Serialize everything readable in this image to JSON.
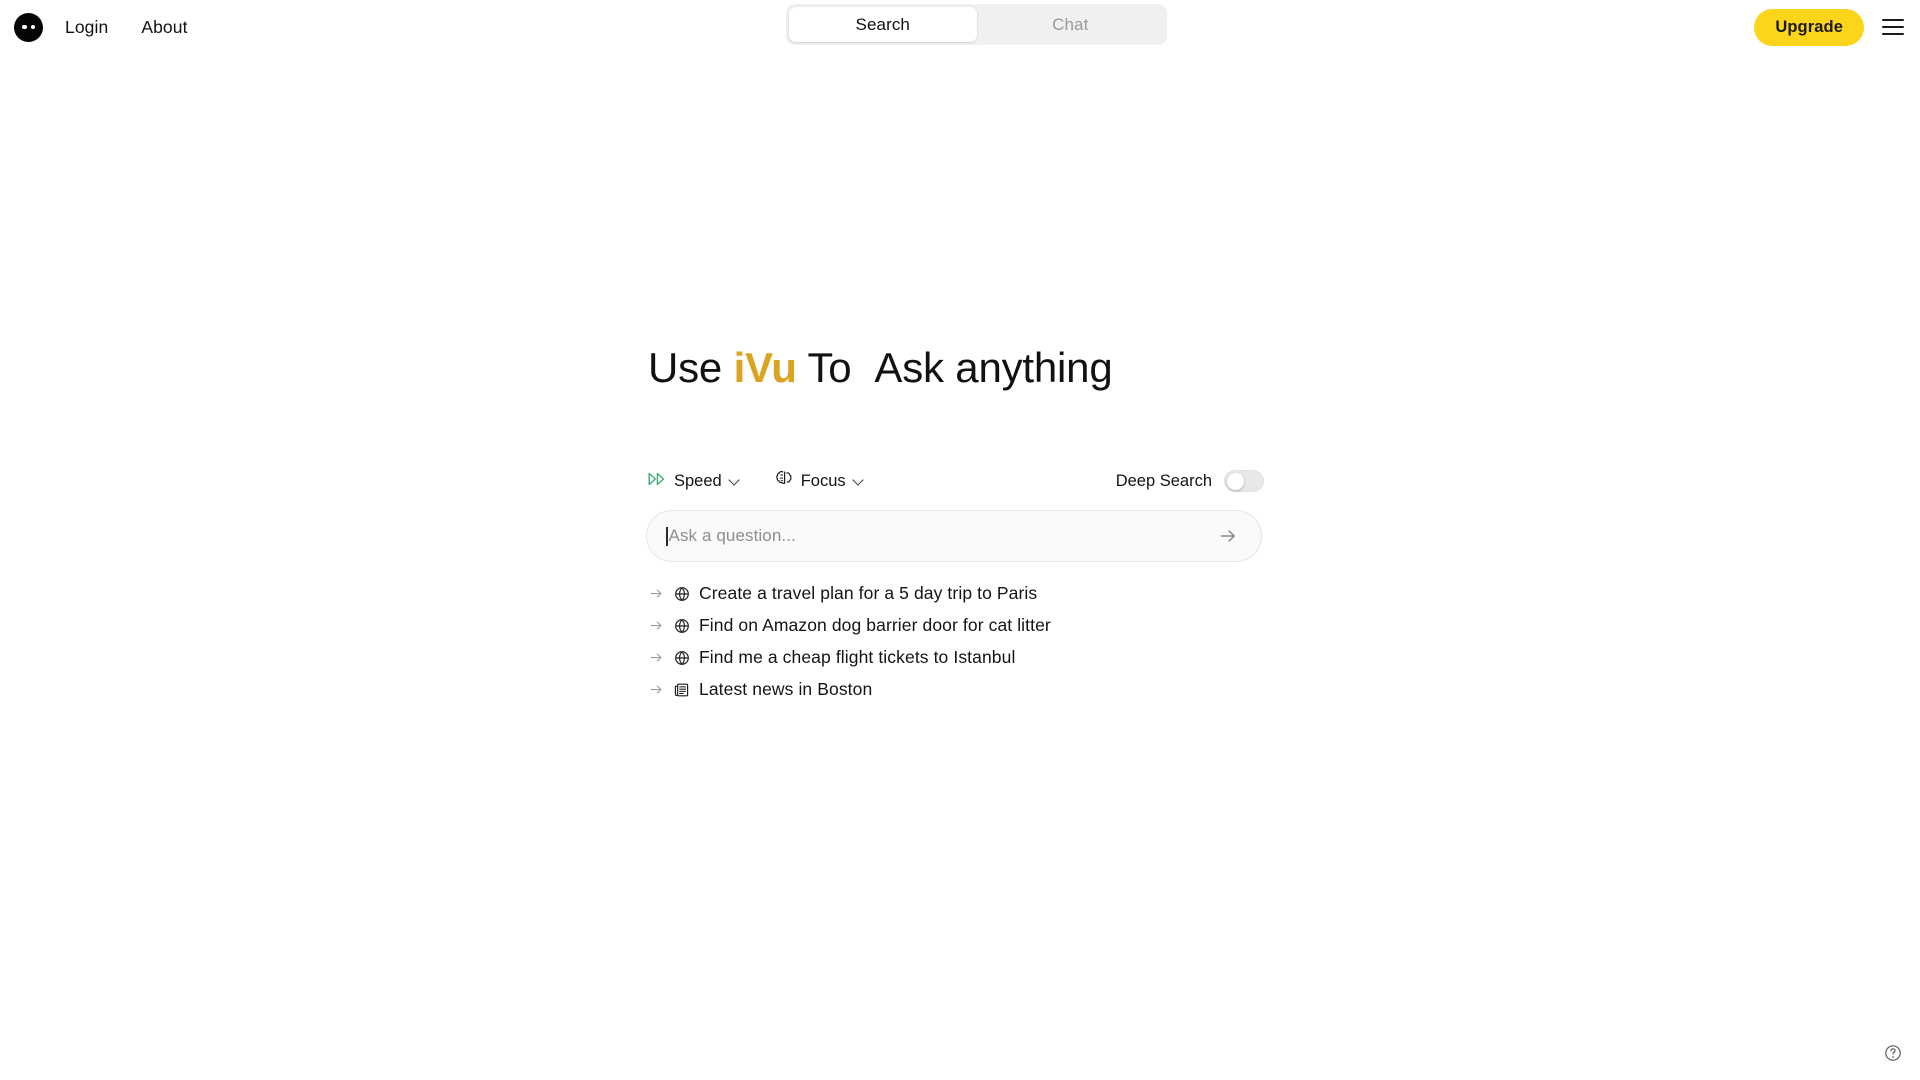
{
  "topbar": {
    "logo": {
      "icon": "app-logo-dots-icon"
    },
    "nav": [
      {
        "label": "Login",
        "name": "nav-link-login"
      },
      {
        "label": "About",
        "name": "nav-link-about"
      }
    ],
    "tabs": [
      {
        "label": "Search",
        "active": true
      },
      {
        "label": "Chat",
        "active": false
      }
    ],
    "upgrade_label": "Upgrade",
    "menu_icon": "hamburger-menu-icon",
    "colors": {
      "upgrade_bg": "#fcd419",
      "upgrade_text": "#1b1b1b",
      "tab_container_bg": "#f0f0f1",
      "tab_active_bg": "#ffffff",
      "tab_inactive_text": "#9a9a9f"
    }
  },
  "hero": {
    "headline_prefix": "Use",
    "headline_brand": "iVu",
    "headline_middle": "To",
    "headline_suffix": "Ask anything",
    "brand_color": "#d9a520"
  },
  "controls": {
    "speed": {
      "label": "Speed",
      "icon": "fast-forward-icon",
      "icon_color": "#4caf7d"
    },
    "focus": {
      "label": "Focus",
      "icon": "brain-icon"
    },
    "deep_search": {
      "label": "Deep Search",
      "enabled": false
    }
  },
  "search": {
    "placeholder": "Ask a question...",
    "value": "",
    "submit_icon": "arrow-right-icon"
  },
  "suggestions": [
    {
      "text": "Create a travel plan for a 5 day trip to Paris",
      "icon": "globe-icon"
    },
    {
      "text": "Find on Amazon dog barrier door for cat litter",
      "icon": "globe-icon"
    },
    {
      "text": "Find me a cheap flight tickets to Istanbul",
      "icon": "globe-icon"
    },
    {
      "text": "Latest news in Boston",
      "icon": "newspaper-icon"
    }
  ],
  "help": {
    "icon": "help-circle-icon"
  }
}
